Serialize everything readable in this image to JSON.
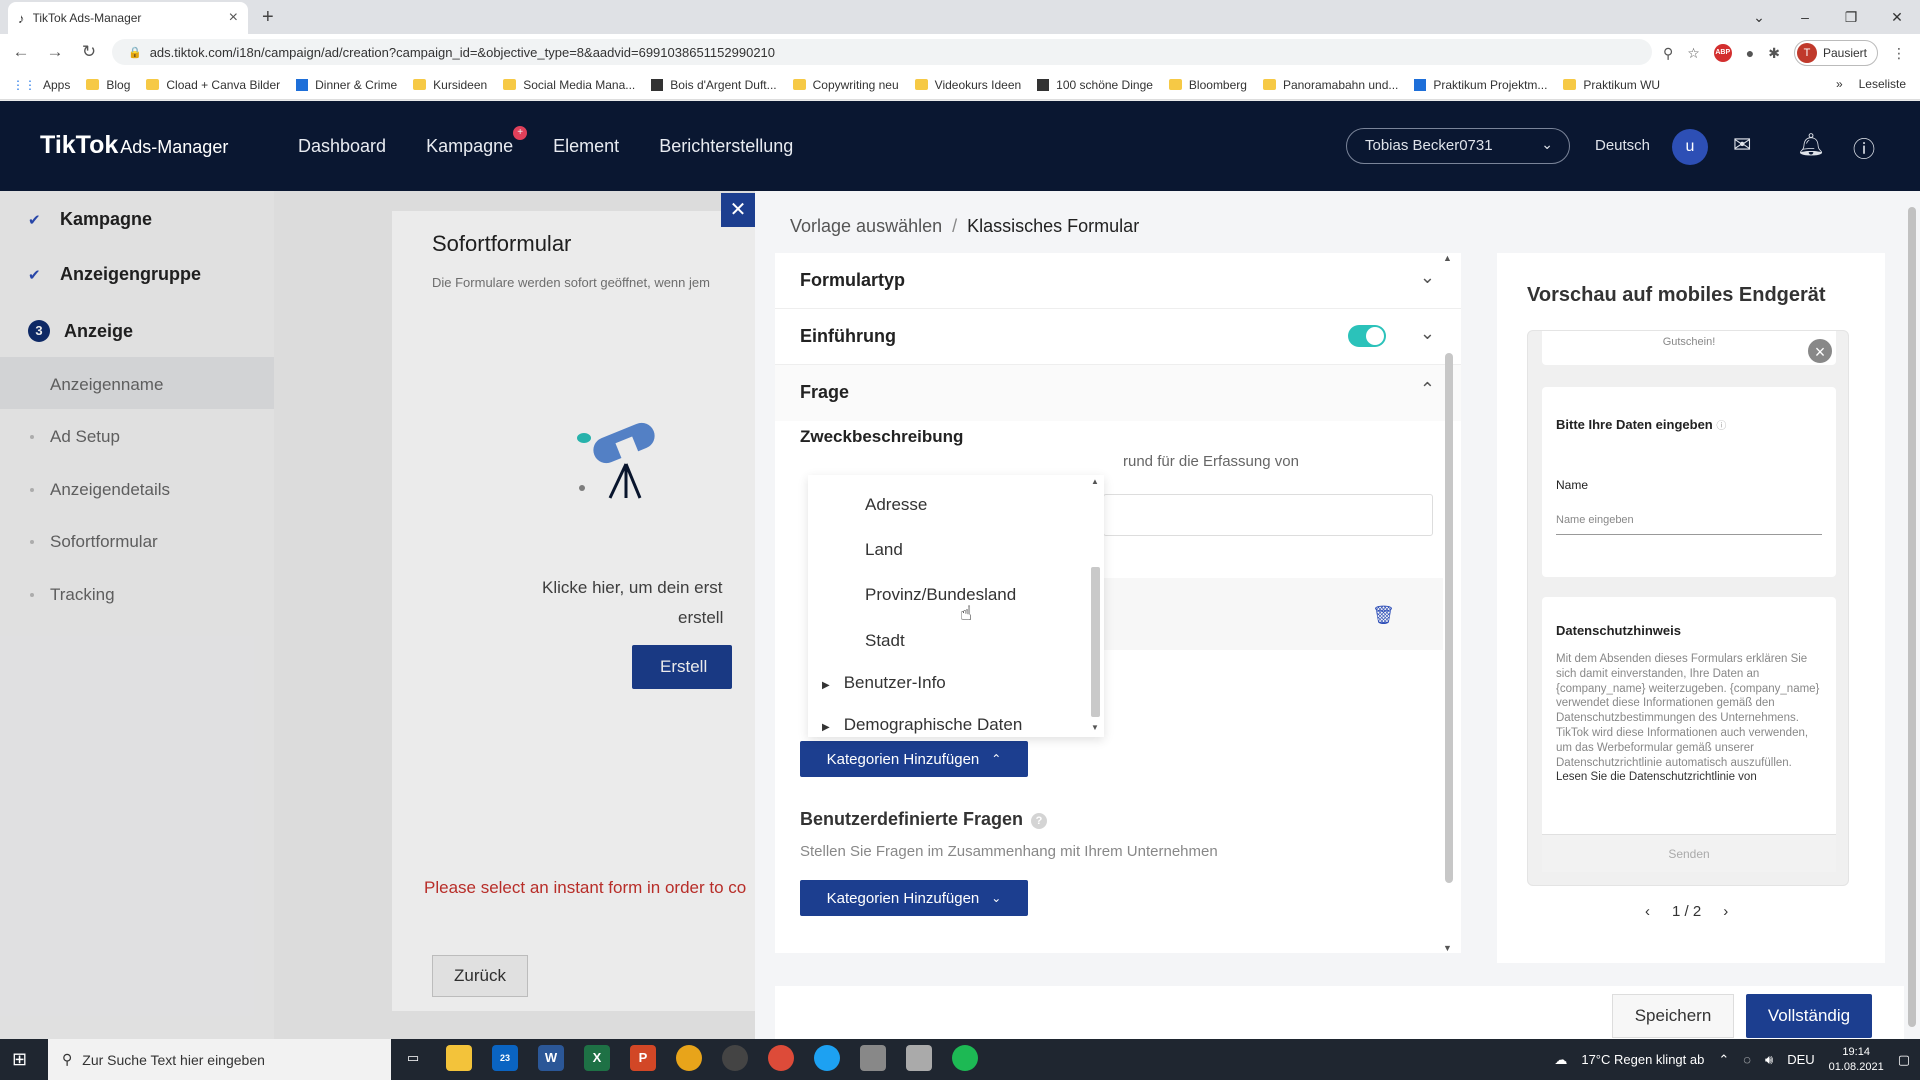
{
  "browser": {
    "tab_title": "TikTok Ads-Manager",
    "tab_close": "×",
    "new_tab": "+",
    "url": "ads.tiktok.com/i18n/campaign/ad/creation?campaign_id=&objective_type=8&aadvid=6991038651152990210",
    "profile_name": "Pausiert",
    "profile_initial": "T",
    "bookmarks": [
      "Apps",
      "Blog",
      "Cload + Canva Bilder",
      "Dinner & Crime",
      "Kursideen",
      "Social Media Mana...",
      "Bois d'Argent Duft...",
      "Copywriting neu",
      "Videokurs Ideen",
      "100 schöne Dinge",
      "Bloomberg",
      "Panoramabahn und...",
      "Praktikum Projektm...",
      "Praktikum WU"
    ],
    "bookmarks_more": "»",
    "reading_list": "Leseliste"
  },
  "header": {
    "logo": "TikTok",
    "logo_sub": "Ads-Manager",
    "nav": [
      "Dashboard",
      "Kampagne",
      "Element",
      "Berichterstellung"
    ],
    "account": "Tobias Becker0731",
    "language": "Deutsch",
    "avatar_initial": "u"
  },
  "sidebar": {
    "steps": [
      {
        "label": "Kampagne",
        "state": "done"
      },
      {
        "label": "Anzeigengruppe",
        "state": "done"
      },
      {
        "label": "Anzeige",
        "number": "3",
        "state": "current"
      }
    ],
    "substeps": [
      "Anzeigenname",
      "Ad Setup",
      "Anzeigendetails",
      "Sofortformular",
      "Tracking"
    ]
  },
  "main": {
    "title": "Sofortformular",
    "desc": "Die Formulare werden sofort geöffnet, wenn jem",
    "message_line1": "Klicke hier, um dein erst",
    "message_line2": "erstell",
    "create_button": "Erstell",
    "error": "Please select an instant form in order to co",
    "back_button": "Zurück"
  },
  "panel": {
    "breadcrumb": [
      "Vorlage auswählen",
      "Klassisches Formular"
    ],
    "sections": {
      "formulartyp": "Formulartyp",
      "einfuehrung": "Einführung",
      "frage": "Frage"
    },
    "zweck_title": "Zweckbeschreibung",
    "zweck_partial": "rund für die Erfassung von",
    "dropdown_items": [
      "Adresse",
      "Land",
      "Provinz/Bundesland",
      "Stadt"
    ],
    "dropdown_groups": [
      "Benutzer-Info",
      "Demographische Daten"
    ],
    "add_categories_1": "Kategorien Hinzufügen",
    "custom_title": "Benutzerdefinierte Fragen",
    "custom_desc": "Stellen Sie Fragen im Zusammenhang mit Ihrem Unternehmen",
    "add_categories_2": "Kategorien Hinzufügen",
    "save": "Speichern",
    "complete": "Vollständig"
  },
  "preview": {
    "title": "Vorschau auf mobiles Endgerät",
    "top_text": "Gutschein!",
    "data_heading": "Bitte Ihre Daten eingeben",
    "name_label": "Name",
    "name_placeholder": "Name eingeben",
    "privacy_heading": "Datenschutzhinweis",
    "privacy_text": " Mit dem Absenden dieses Formulars erklären Sie sich damit einverstanden, Ihre Daten an {company_name} weiterzugeben. {company_name} verwendet diese Informationen gemäß den Datenschutzbestimmungen des Unternehmens. TikTok wird diese Informationen auch verwenden, um das Werbeformular gemäß unserer Datenschutzrichtlinie automatisch auszufüllen.",
    "privacy_link": "Lesen Sie die Datenschutzrichtlinie von",
    "send": "Senden",
    "pager": "1 / 2"
  },
  "taskbar": {
    "search": "Zur Suche Text hier eingeben",
    "mail_badge": "23",
    "weather": "17°C  Regen klingt ab",
    "lang": "DEU",
    "time": "19:14",
    "date": "01.08.2021"
  },
  "colors": {
    "header_bg": "#0a1731",
    "primary": "#1c3e8f",
    "toggle": "#2bc2ba",
    "error": "#c8322d"
  }
}
